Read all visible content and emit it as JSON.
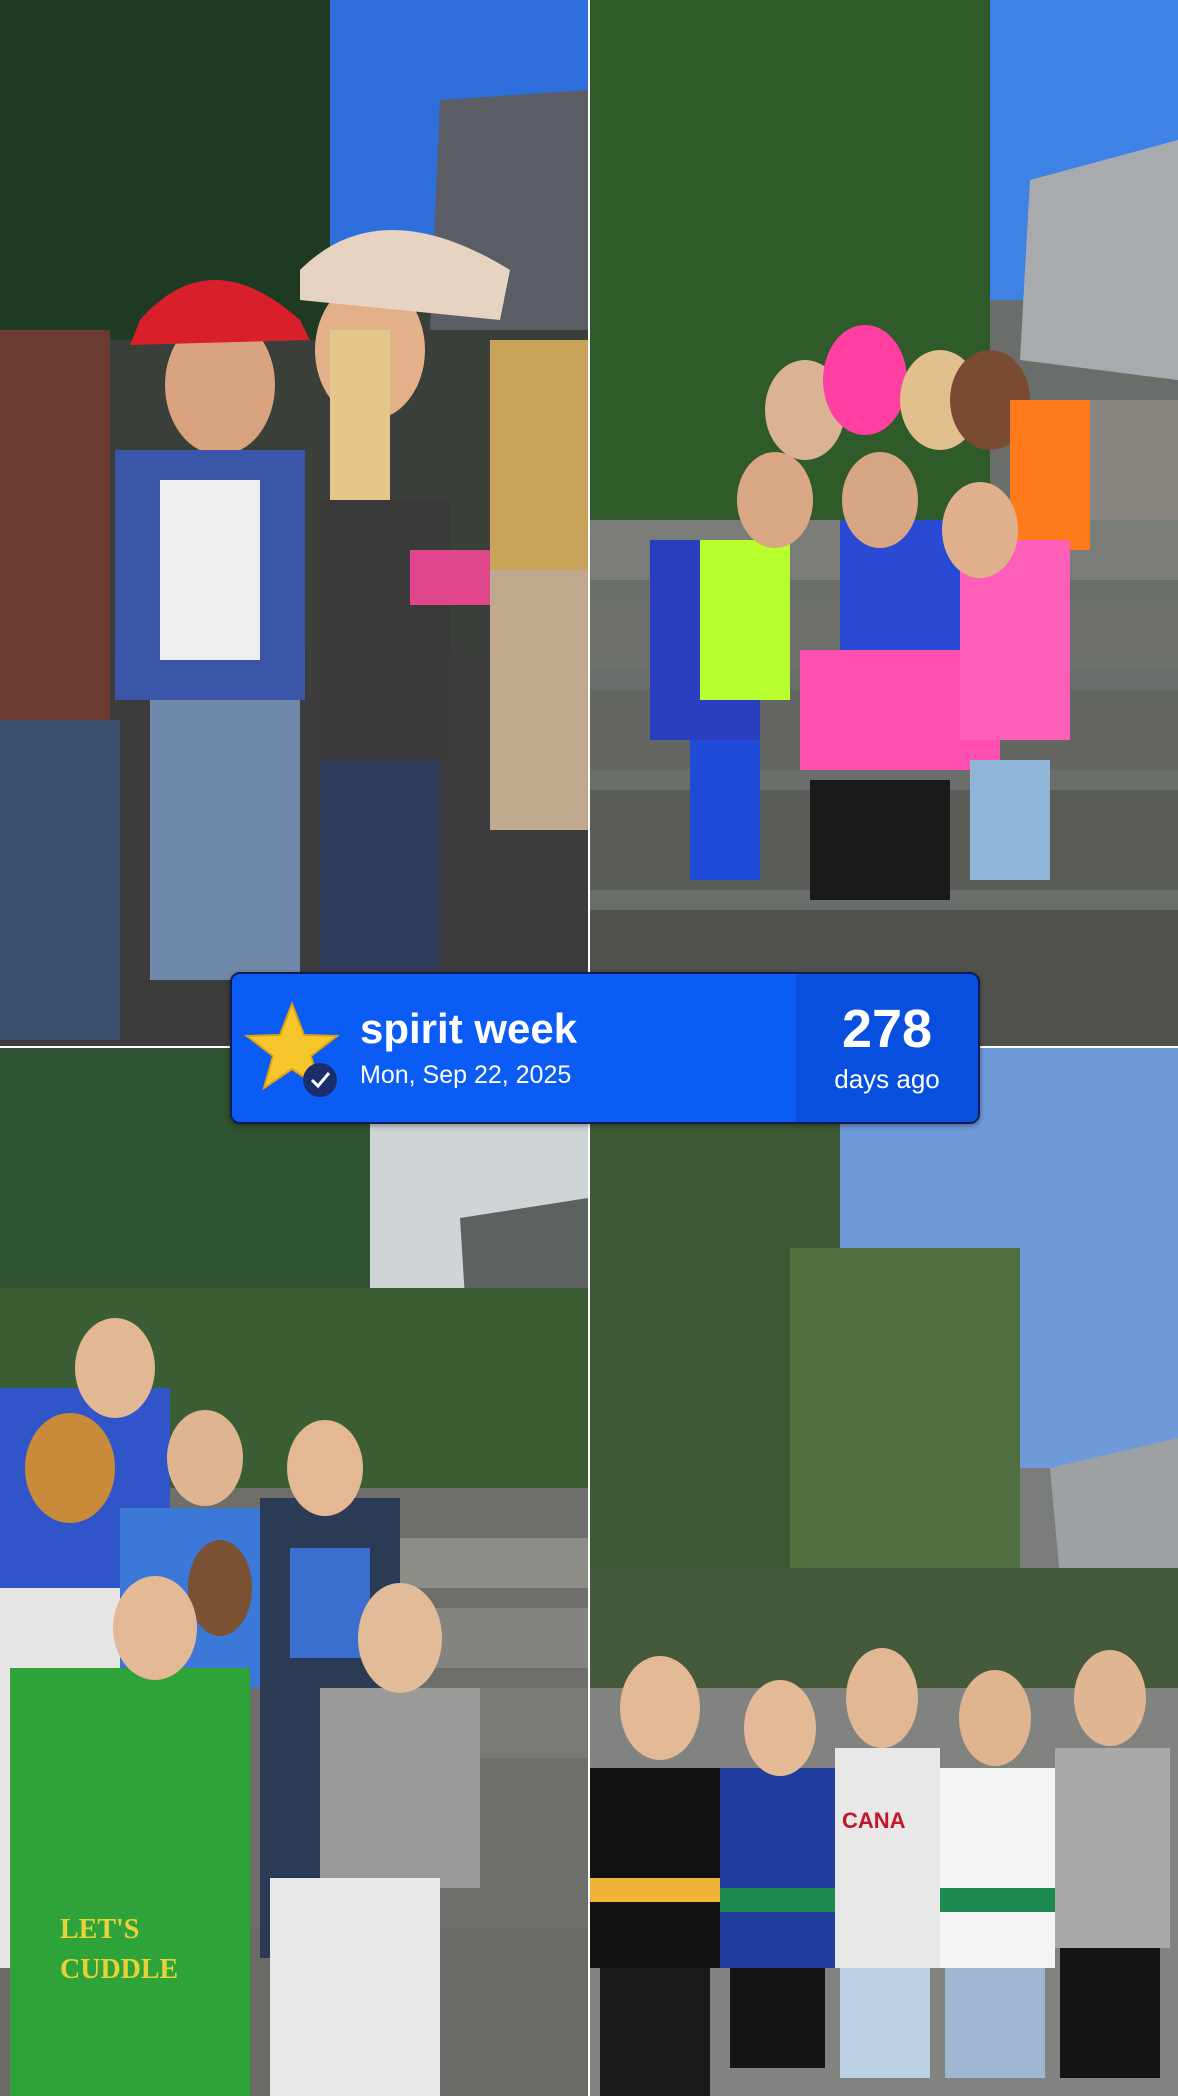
{
  "banner": {
    "title": "spirit week",
    "date": "Mon, Sep 22, 2025",
    "count": "278",
    "count_label": "days ago",
    "icon": "star-icon",
    "badge_icon": "check-badge-icon",
    "colors": {
      "main": "#0a5cf5",
      "side": "#084fe0",
      "border": "#0b1a55",
      "star": "#f7c62b"
    }
  },
  "photos": {
    "top_left": {
      "jersey_text": ""
    },
    "bottom_left": {
      "onesie_text": "LET'S\nCUDDLE"
    },
    "bottom_right": {
      "jersey_text": "CANADA"
    }
  }
}
